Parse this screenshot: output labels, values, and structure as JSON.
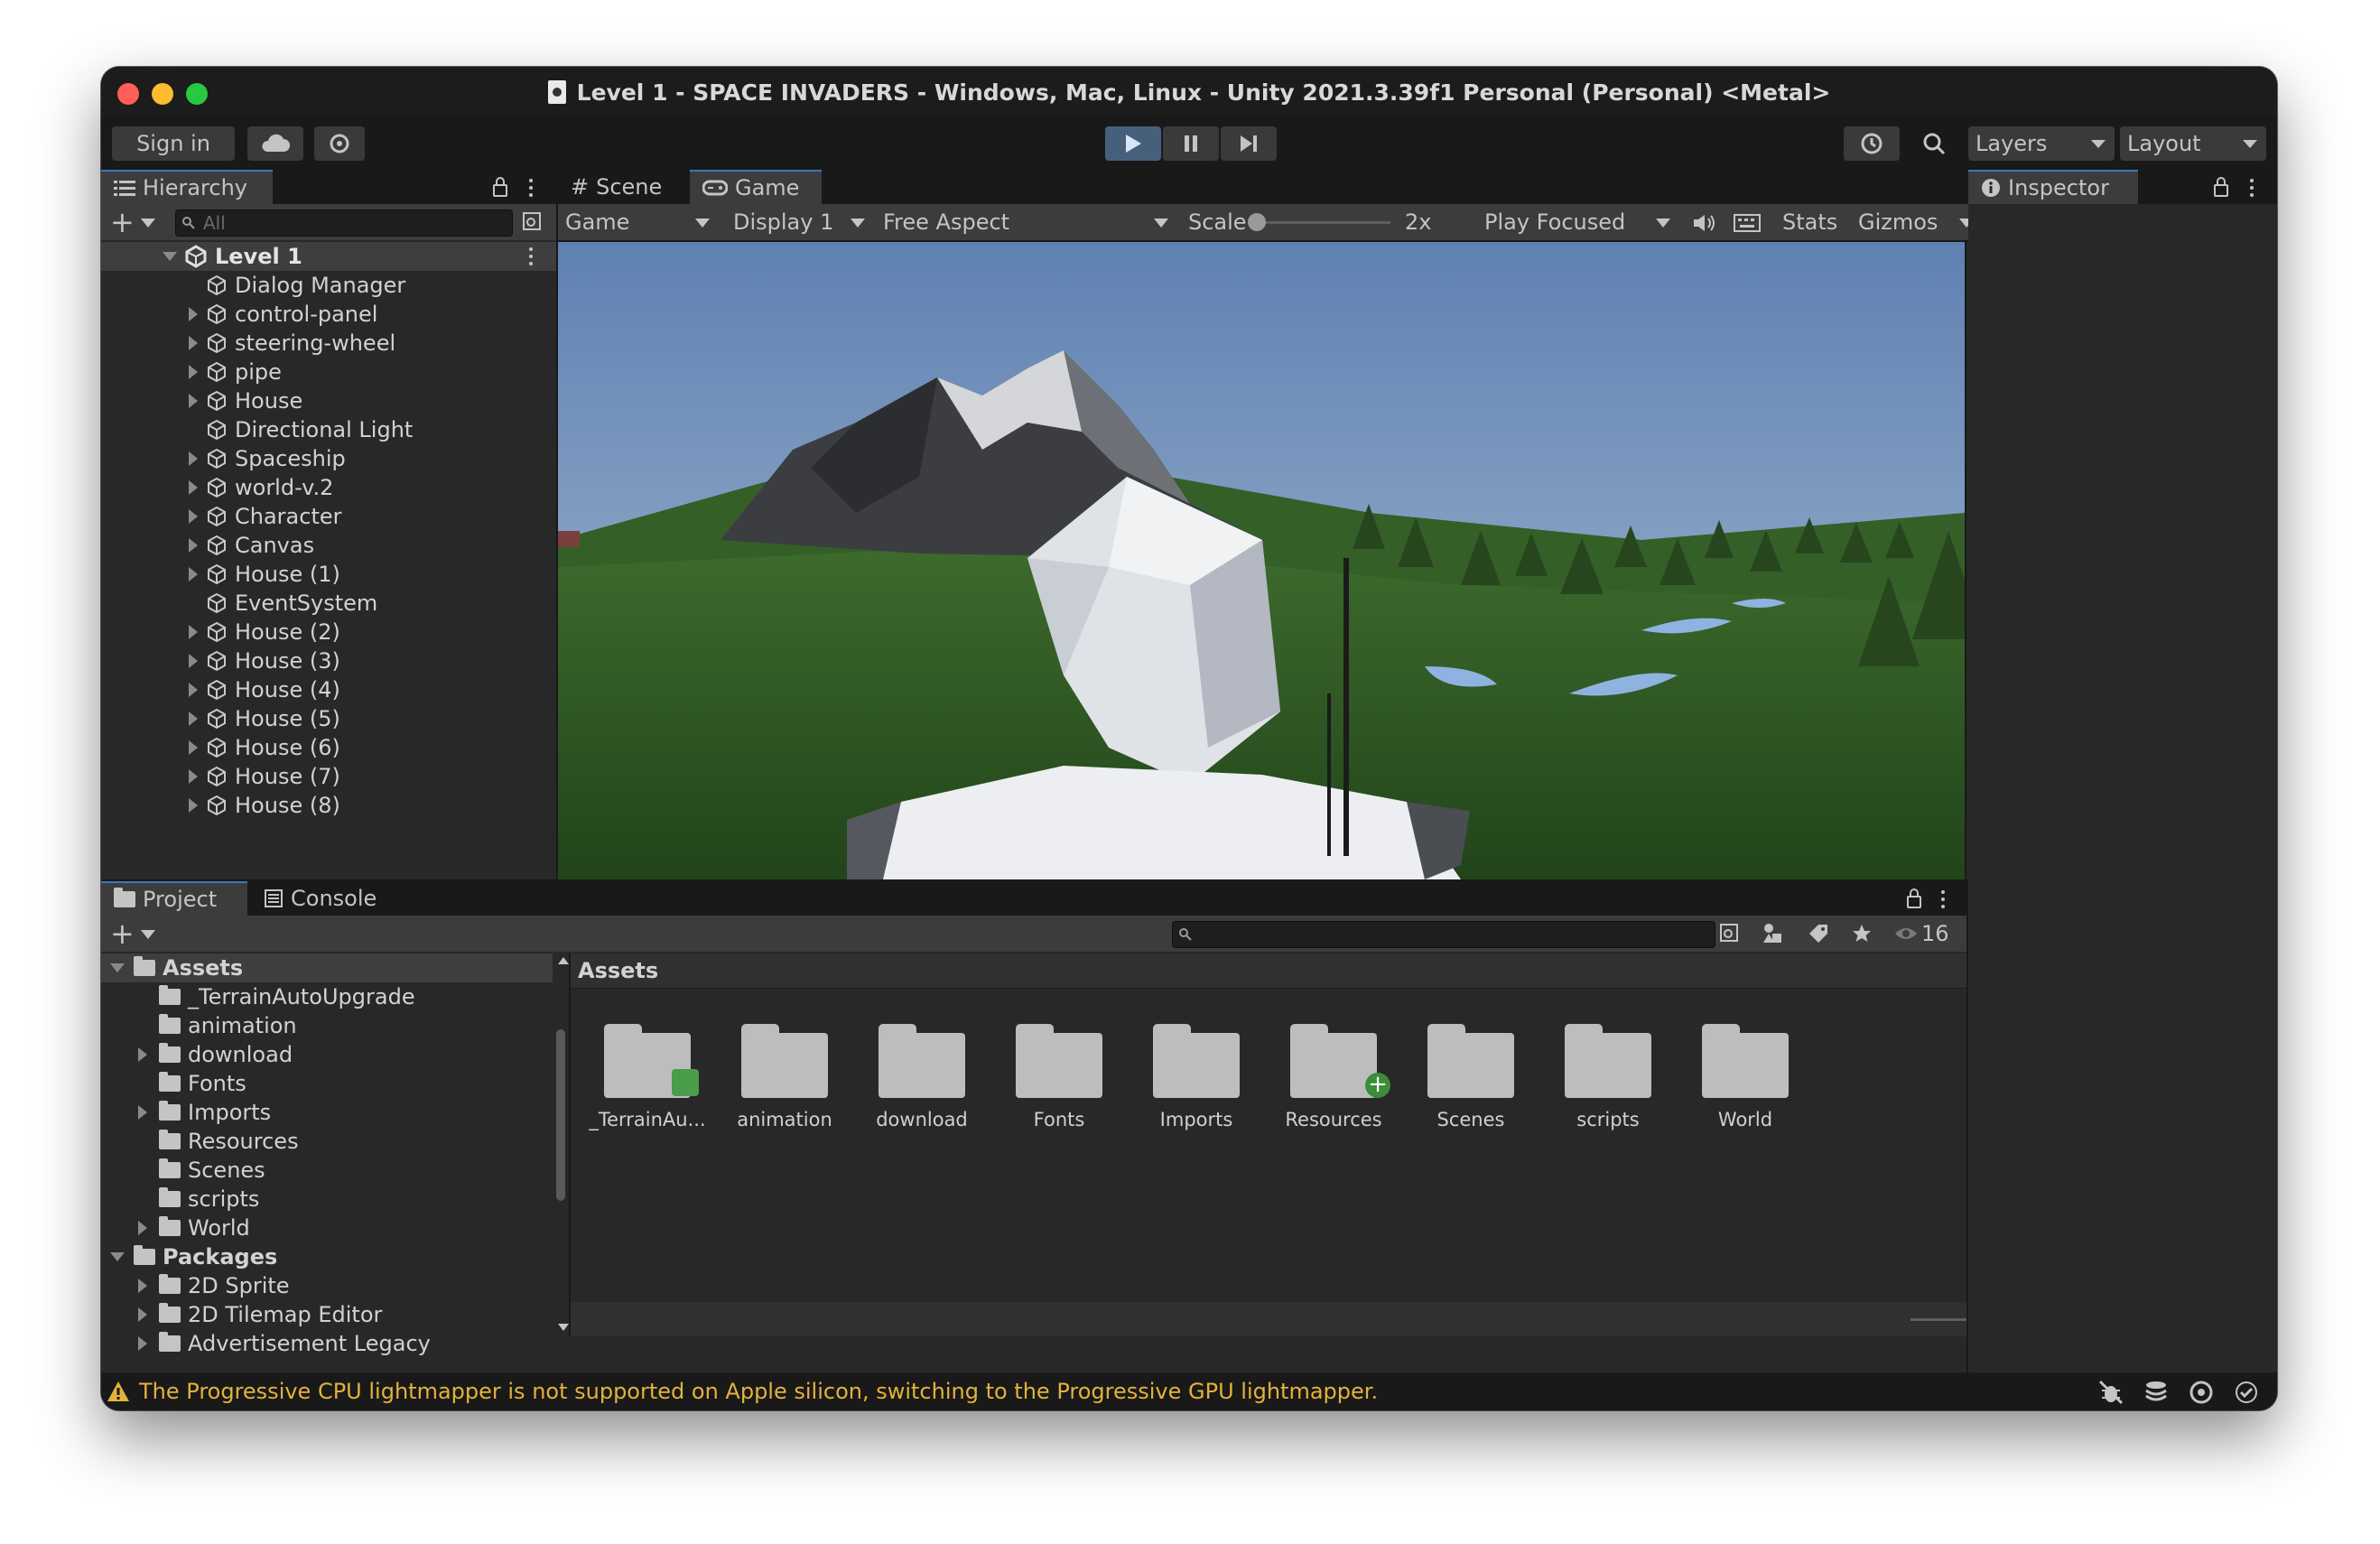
{
  "window": {
    "title": "Level 1 - SPACE INVADERS - Windows, Mac, Linux - Unity 2021.3.39f1 Personal (Personal) <Metal>"
  },
  "toolbar": {
    "sign_in": "Sign in",
    "layers": "Layers",
    "layout": "Layout",
    "play_icon": "play-icon",
    "pause_icon": "pause-icon",
    "step_icon": "step-icon"
  },
  "hierarchy": {
    "tab": "Hierarchy",
    "search_placeholder": "All",
    "scene": "Level 1",
    "items": [
      {
        "label": "Dialog Manager",
        "expandable": false
      },
      {
        "label": "control-panel",
        "expandable": true
      },
      {
        "label": "steering-wheel",
        "expandable": true
      },
      {
        "label": "pipe",
        "expandable": true
      },
      {
        "label": "House",
        "expandable": true
      },
      {
        "label": "Directional Light",
        "expandable": false
      },
      {
        "label": "Spaceship",
        "expandable": true
      },
      {
        "label": "world-v.2",
        "expandable": true
      },
      {
        "label": "Character",
        "expandable": true
      },
      {
        "label": "Canvas",
        "expandable": true
      },
      {
        "label": "House (1)",
        "expandable": true
      },
      {
        "label": "EventSystem",
        "expandable": false
      },
      {
        "label": "House (2)",
        "expandable": true
      },
      {
        "label": "House (3)",
        "expandable": true
      },
      {
        "label": "House (4)",
        "expandable": true
      },
      {
        "label": "House (5)",
        "expandable": true
      },
      {
        "label": "House (6)",
        "expandable": true
      },
      {
        "label": "House (7)",
        "expandable": true
      },
      {
        "label": "House (8)",
        "expandable": true
      }
    ]
  },
  "game_view": {
    "tabs": [
      "Scene",
      "Game"
    ],
    "game_dropdown": "Game",
    "display": "Display 1",
    "aspect": "Free Aspect",
    "scale_label": "Scale",
    "scale_value": "2x",
    "play_mode": "Play Focused",
    "stats": "Stats",
    "gizmos": "Gizmos"
  },
  "inspector": {
    "tab": "Inspector"
  },
  "project": {
    "tabs": [
      "Project",
      "Console"
    ],
    "badge_count": "16",
    "tree": [
      {
        "label": "Assets",
        "level": 0,
        "expanded": true,
        "bold": true
      },
      {
        "label": "_TerrainAutoUpgrade",
        "level": 1,
        "expandable": false
      },
      {
        "label": "animation",
        "level": 1,
        "expandable": false
      },
      {
        "label": "download",
        "level": 1,
        "expandable": true
      },
      {
        "label": "Fonts",
        "level": 1,
        "expandable": false
      },
      {
        "label": "Imports",
        "level": 1,
        "expandable": true
      },
      {
        "label": "Resources",
        "level": 1,
        "expandable": false
      },
      {
        "label": "Scenes",
        "level": 1,
        "expandable": false
      },
      {
        "label": "scripts",
        "level": 1,
        "expandable": false
      },
      {
        "label": "World",
        "level": 1,
        "expandable": true
      },
      {
        "label": "Packages",
        "level": 0,
        "expanded": true,
        "bold": true
      },
      {
        "label": "2D Sprite",
        "level": 1,
        "expandable": true
      },
      {
        "label": "2D Tilemap Editor",
        "level": 1,
        "expandable": true
      },
      {
        "label": "Advertisement Legacy",
        "level": 1,
        "expandable": true
      }
    ],
    "breadcrumb": "Assets",
    "folders": [
      "_TerrainAu...",
      "animation",
      "download",
      "Fonts",
      "Imports",
      "Resources",
      "Scenes",
      "scripts",
      "World"
    ]
  },
  "status": {
    "message": "The Progressive CPU lightmapper is not supported on Apple silicon, switching to the Progressive GPU lightmapper.",
    "warning_color": "#e2b33b"
  }
}
